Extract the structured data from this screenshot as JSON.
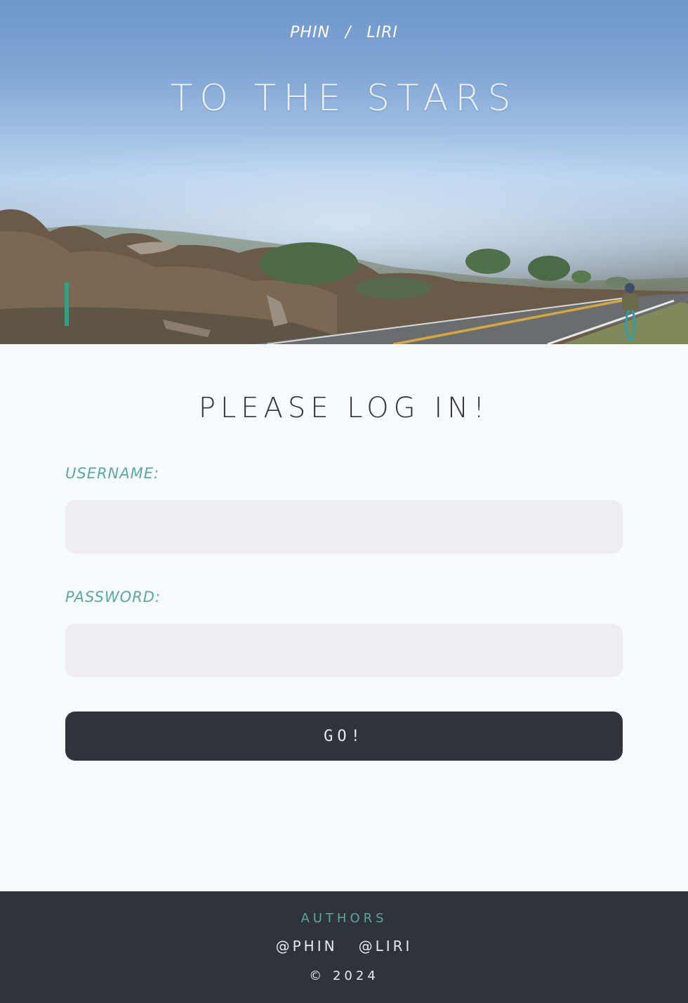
{
  "header": {
    "nav": [
      {
        "label": "Phin"
      },
      {
        "label": "Liri"
      }
    ],
    "separator": "/",
    "title": "To the stars",
    "hero_image": "foggy coastal road with cyclist and fogbow"
  },
  "login": {
    "heading": "Please log in!",
    "username_label": "Username:",
    "username_value": "",
    "password_label": "Password:",
    "password_value": "",
    "submit_label": "Go!"
  },
  "footer": {
    "heading": "Authors",
    "links": [
      {
        "label": "@Phin"
      },
      {
        "label": "@Liri"
      }
    ],
    "copyright": "© 2024"
  },
  "colors": {
    "background": "#f5fbfd",
    "accent": "#5fa5a0",
    "dark": "#2f333c",
    "input_bg": "#efedf1"
  }
}
